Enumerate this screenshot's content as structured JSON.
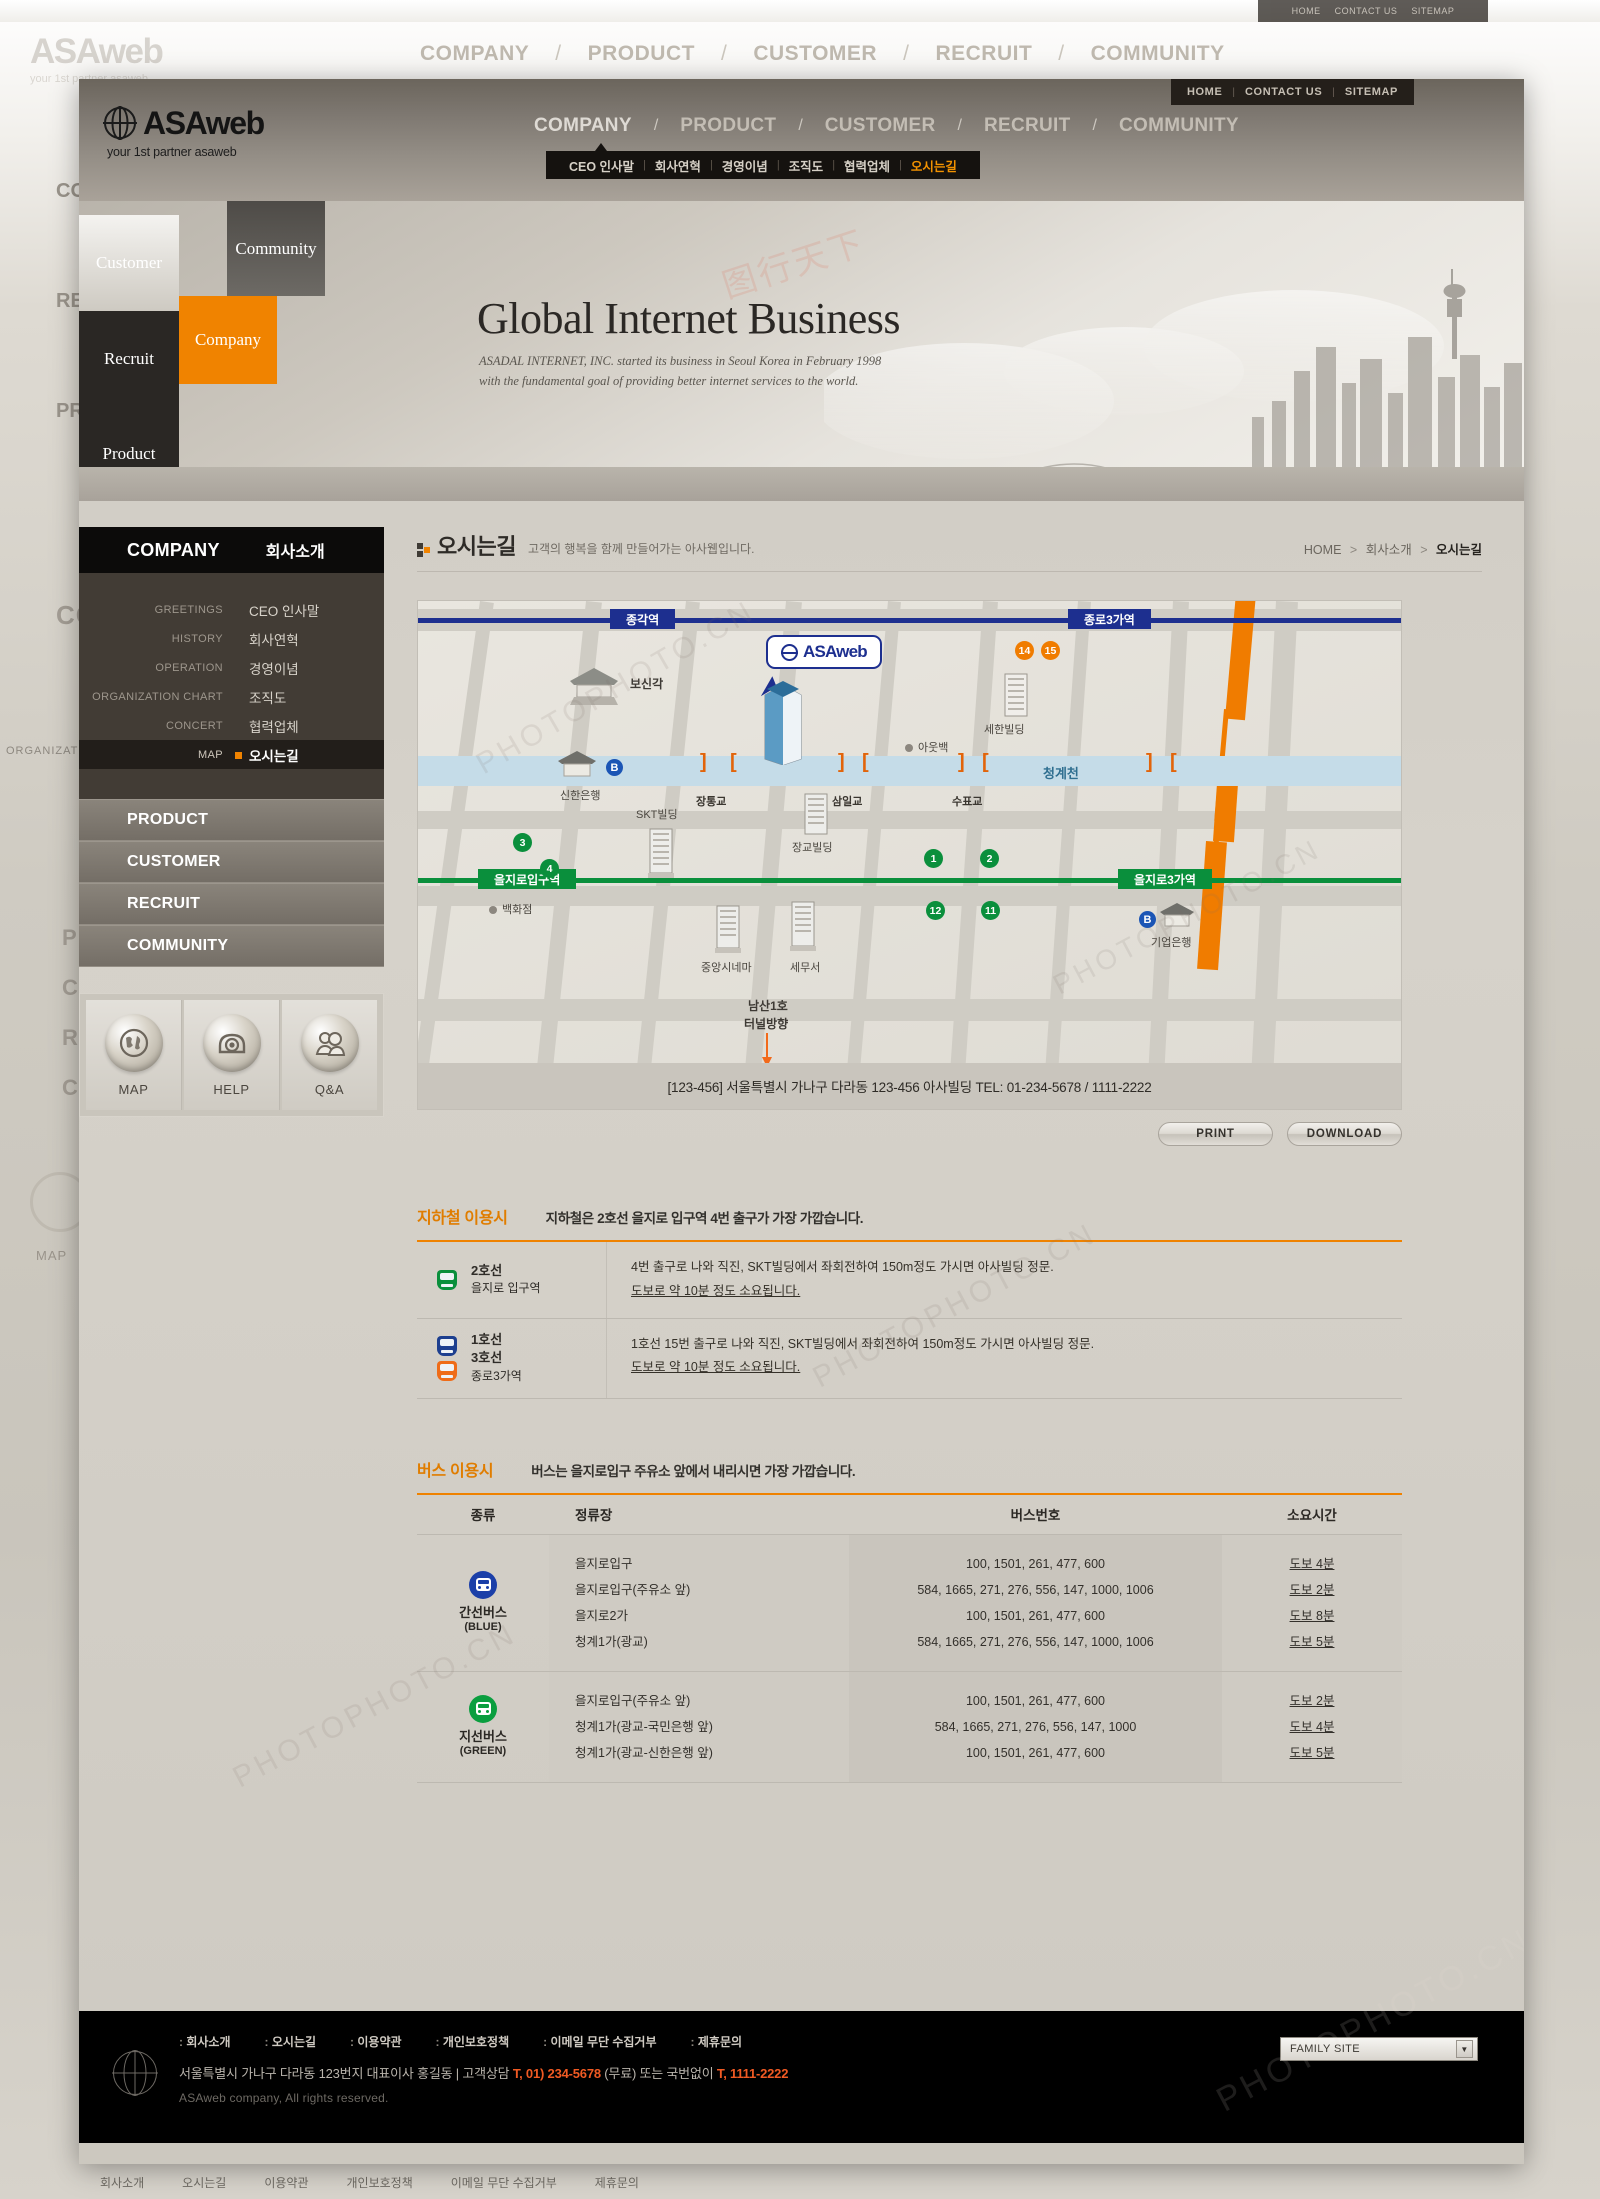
{
  "utility": {
    "items": [
      "HOME",
      "CONTACT US",
      "SITEMAP"
    ]
  },
  "brand": {
    "name": "ASAweb",
    "tagline": "your 1st partner asaweb"
  },
  "mainnav": {
    "items": [
      "COMPANY",
      "PRODUCT",
      "CUSTOMER",
      "RECRUIT",
      "COMMUNITY"
    ],
    "separator": "/"
  },
  "subnav": {
    "items": [
      "CEO 인사말",
      "회사연혁",
      "경영이념",
      "조직도",
      "협력업체",
      "오시는길"
    ],
    "active": "오시는길",
    "separator": "|"
  },
  "hero": {
    "tiles": [
      "Customer",
      "Community",
      "Recruit",
      "Company",
      "Product"
    ],
    "title": "Global Internet Business",
    "desc_line1": "ASADAL INTERNET, INC. started its business in Seoul Korea in February 1998",
    "desc_line2": "with the fundamental goal of providing better internet services to the world."
  },
  "sidebar": {
    "header": {
      "en": "COMPANY",
      "ko": "회사소개"
    },
    "items": [
      {
        "en": "GREETINGS",
        "ko": "CEO 인사말",
        "active": false
      },
      {
        "en": "HISTORY",
        "ko": "회사연혁",
        "active": false
      },
      {
        "en": "OPERATION",
        "ko": "경영이념",
        "active": false
      },
      {
        "en": "ORGANIZATION CHART",
        "ko": "조직도",
        "active": false
      },
      {
        "en": "CONCERT",
        "ko": "협력업체",
        "active": false
      },
      {
        "en": "MAP",
        "ko": "오시는길",
        "active": true
      }
    ],
    "main_items": [
      "PRODUCT",
      "CUSTOMER",
      "RECRUIT",
      "COMMUNITY"
    ],
    "quick": [
      {
        "label": "MAP",
        "icon": "globe-icon"
      },
      {
        "label": "HELP",
        "icon": "phone-icon"
      },
      {
        "label": "Q&A",
        "icon": "people-icon"
      }
    ]
  },
  "page": {
    "title": "오시는길",
    "desc": "고객의 행복을 함께 만들어가는 아사웹입니다.",
    "breadcrumb": [
      "HOME",
      "회사소개",
      "오시는길"
    ],
    "breadcrumb_sep": ">"
  },
  "map": {
    "balloon": "ASAweb",
    "subway_stations": [
      {
        "name": "종각역",
        "line": "blue"
      },
      {
        "name": "종로3가역",
        "line": "blue"
      },
      {
        "name": "을지로입구역",
        "line": "green"
      },
      {
        "name": "을지로3가역",
        "line": "green"
      }
    ],
    "exit_numbers": [
      "14",
      "15",
      "1",
      "2",
      "3",
      "4",
      "11",
      "12"
    ],
    "landmarks": [
      "보신각",
      "신한은행",
      "SKT빌딩",
      "장교빌딩",
      "세한빌딩",
      "아웃백",
      "백화점",
      "중앙시네마",
      "세무서",
      "기업은행"
    ],
    "river": "청계천",
    "bridges": [
      "장통교",
      "삼일교",
      "수표교"
    ],
    "direction_note_1": "남산1호",
    "direction_note_2": "터널방향",
    "address_bar": "[123-456] 서울특별시 가나구 다라동 123-456 아사빌딩   TEL: 01-234-5678  /  1111-2222",
    "buttons": [
      "PRINT",
      "DOWNLOAD"
    ]
  },
  "subway_section": {
    "title": "지하철 이용시",
    "note": "지하철은 2호선 을지로 입구역 4번 출구가 가장 가깝습니다.",
    "rows": [
      {
        "lines": [
          "2호선"
        ],
        "colors": [
          "#0a8f3c"
        ],
        "station": "을지로 입구역",
        "text1": "4번 출구로 나와 직진, SKT빌딩에서 좌회전하여 150m정도 가시면 아사빌딩 정문.",
        "text2": "도보로 약 10분 정도 소요됩니다."
      },
      {
        "lines": [
          "1호선",
          "3호선"
        ],
        "colors": [
          "#1d3f8f",
          "#ef6c18"
        ],
        "station": "종로3가역",
        "text1": "1호선 15번 출구로 나와 직진, SKT빌딩에서 좌회전하여 150m정도 가시면 아사빌딩 정문.",
        "text2": "도보로 약 10분 정도 소요됩니다."
      }
    ]
  },
  "bus_section": {
    "title": "버스 이용시",
    "note": "버스는 을지로입구 주유소 앞에서 내리시면 가장 가깝습니다.",
    "headers": [
      "종류",
      "정류장",
      "버스번호",
      "소요시간"
    ],
    "rows": [
      {
        "type_ko": "간선버스",
        "type_en": "(BLUE)",
        "color": "#1b3fa8",
        "stops": [
          "을지로입구",
          "을지로입구(주유소 앞)",
          "을지로2가",
          "청계1가(광교)"
        ],
        "numbers": [
          "100, 1501, 261, 477, 600",
          "584, 1665, 271, 276, 556, 147, 1000, 1006",
          "100, 1501, 261, 477, 600",
          "584, 1665, 271, 276, 556, 147, 1000, 1006"
        ],
        "times": [
          "도보 4분",
          "도보 2분",
          "도보 8분",
          "도보 5분"
        ]
      },
      {
        "type_ko": "지선버스",
        "type_en": "(GREEN)",
        "color": "#0a9e3f",
        "stops": [
          "을지로입구(주유소 앞)",
          "청계1가(광교-국민은행 앞)",
          "청계1가(광교-신한은행 앞)"
        ],
        "numbers": [
          "100, 1501, 261, 477, 600",
          "584, 1665, 271, 276, 556, 147, 1000",
          "100, 1501, 261, 477, 600"
        ],
        "times": [
          "도보 2분",
          "도보 4분",
          "도보 5분"
        ]
      }
    ]
  },
  "footer": {
    "links": [
      "회사소개",
      "오시는길",
      "이용약관",
      "개인보호정책",
      "이메일 무단 수집거부",
      "제휴문의"
    ],
    "address_prefix": "서울특별시 가나구 다라동 123번지 대표이사 홍길동 | 고객상담 ",
    "tel1": "T, 01) 234-5678",
    "address_mid": " (무료) 또는 국번없이 ",
    "tel2": "T, 1111-2222",
    "copyright": "ASAweb company, All rights reserved.",
    "family_site": "FAMILY SITE",
    "caret": "▼"
  },
  "watermarks": [
    "图行天下",
    "PHOTOPHOTO.CN",
    "图行天下 PHOTO.CN"
  ]
}
